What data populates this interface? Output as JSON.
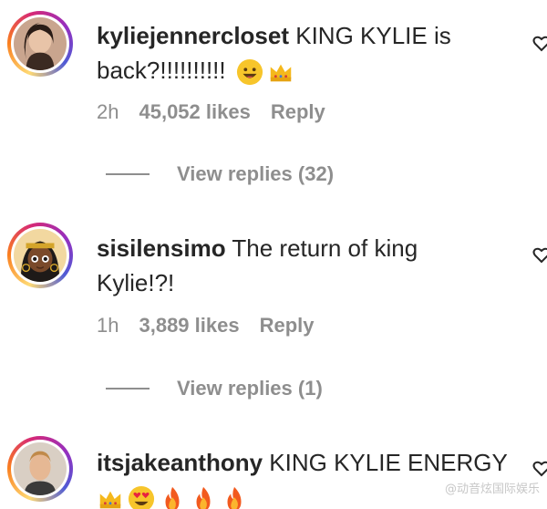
{
  "comments": [
    {
      "username": "kyliejennercloset",
      "line1": "KING KYLIE is",
      "line2": "back?!!!!!!!!!!",
      "emojis": [
        "grinning-face-emoji",
        "crown-emoji"
      ],
      "time": "2h",
      "likes": "45,052 likes",
      "reply_label": "Reply",
      "view_replies": "View replies (32)"
    },
    {
      "username": "sisilensimo",
      "line1": "The return of king",
      "line2": "Kylie!?!",
      "time": "1h",
      "likes": "3,889 likes",
      "reply_label": "Reply",
      "view_replies": "View replies (1)"
    },
    {
      "username": "itsjakeanthony",
      "line1": "KING KYLIE ENERGY",
      "emojis": [
        "crown-emoji",
        "heart-eyes-emoji",
        "fire-emoji",
        "fire-emoji",
        "fire-emoji"
      ]
    }
  ],
  "watermark": "@动音炫国际娱乐",
  "colors": {
    "text": "#262626",
    "secondary": "#8e8e8e",
    "ring_gradient": [
      "#feda75",
      "#fa7e1e",
      "#d62976",
      "#962fbf",
      "#4f5bd5"
    ]
  }
}
